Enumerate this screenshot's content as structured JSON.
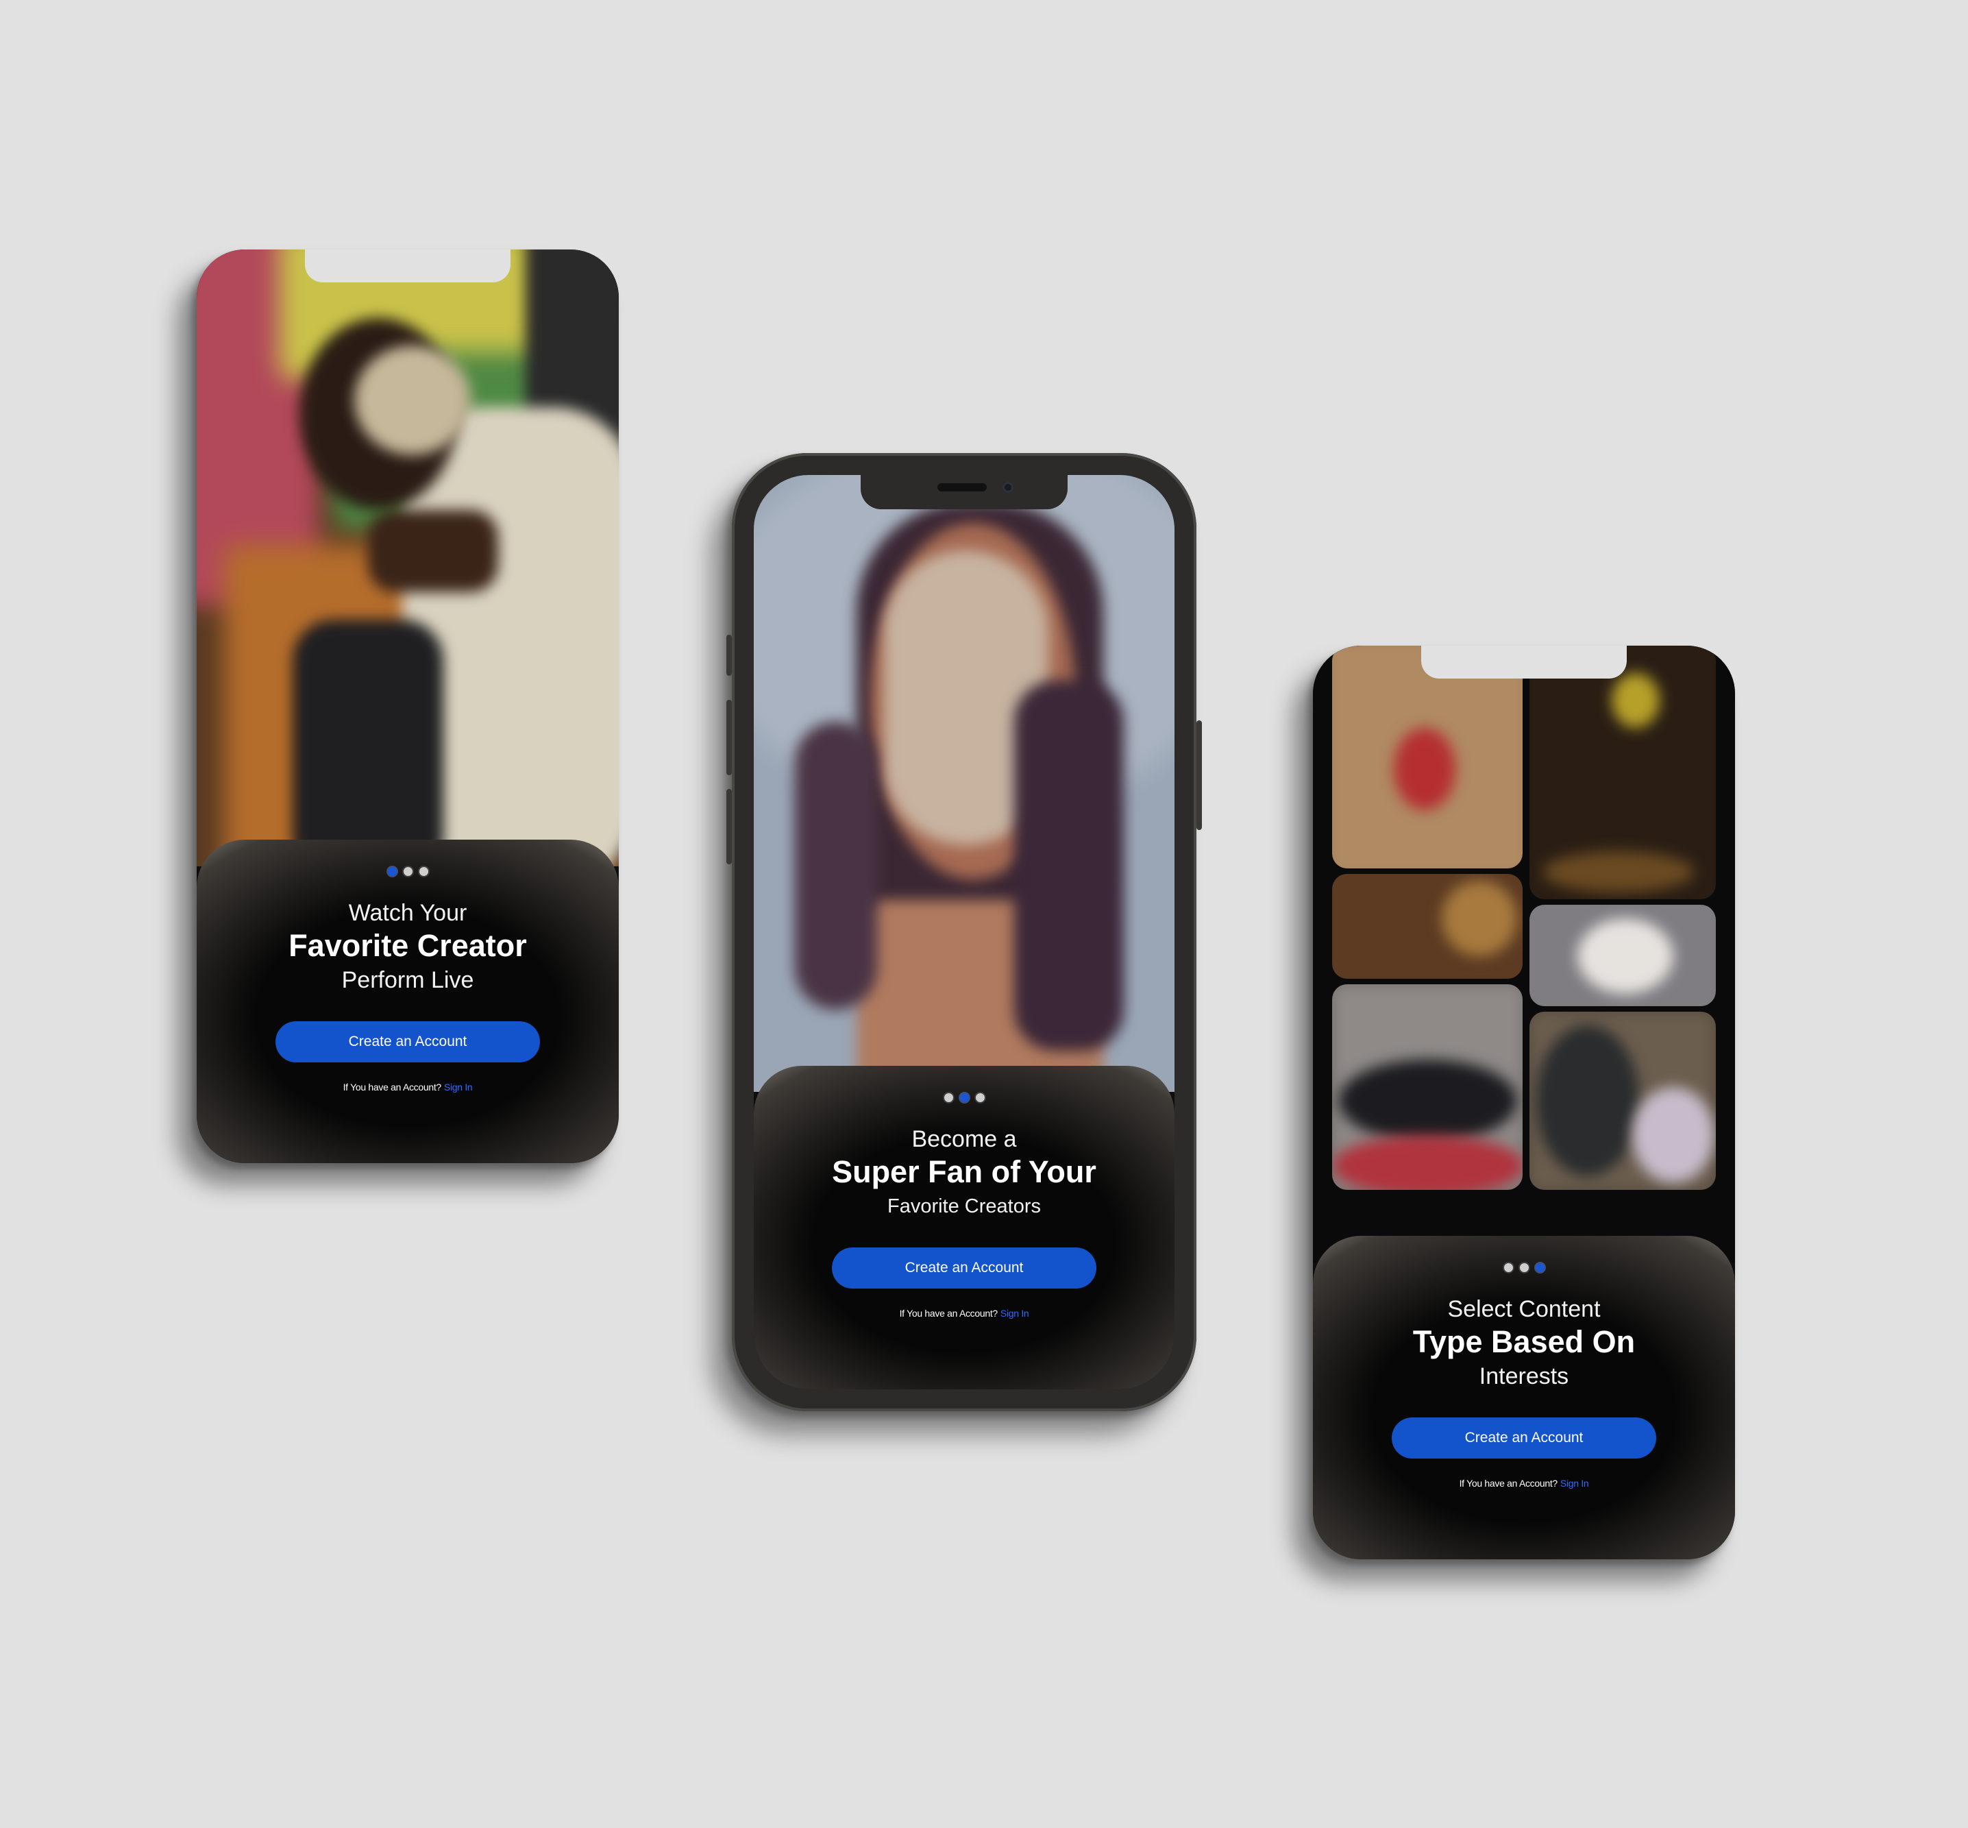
{
  "colors": {
    "background": "#e1e1e1",
    "accent": "#1353cb",
    "link": "#2d6bff",
    "panel": "#0d0d0d"
  },
  "screens": [
    {
      "title_line1": "Watch Your",
      "title_line2": "Favorite Creator",
      "title_line3": "Perform Live",
      "cta_label": "Create an Account",
      "signin_prompt": "If You have an Account?",
      "signin_link": "Sign In",
      "page_indicator": {
        "current": 1,
        "total": 3
      }
    },
    {
      "title_line1": "Become a",
      "title_line2": "Super Fan of Your",
      "title_line3": "Favorite Creators",
      "cta_label": "Create an Account",
      "signin_prompt": "If You have an Account?",
      "signin_link": "Sign In",
      "page_indicator": {
        "current": 2,
        "total": 3
      }
    },
    {
      "title_line1": "Select Content",
      "title_line2": "Type Based On",
      "title_line3": "Interests",
      "cta_label": "Create an Account",
      "signin_prompt": "If You have an Account?",
      "signin_link": "Sign In",
      "page_indicator": {
        "current": 3,
        "total": 3
      }
    }
  ]
}
